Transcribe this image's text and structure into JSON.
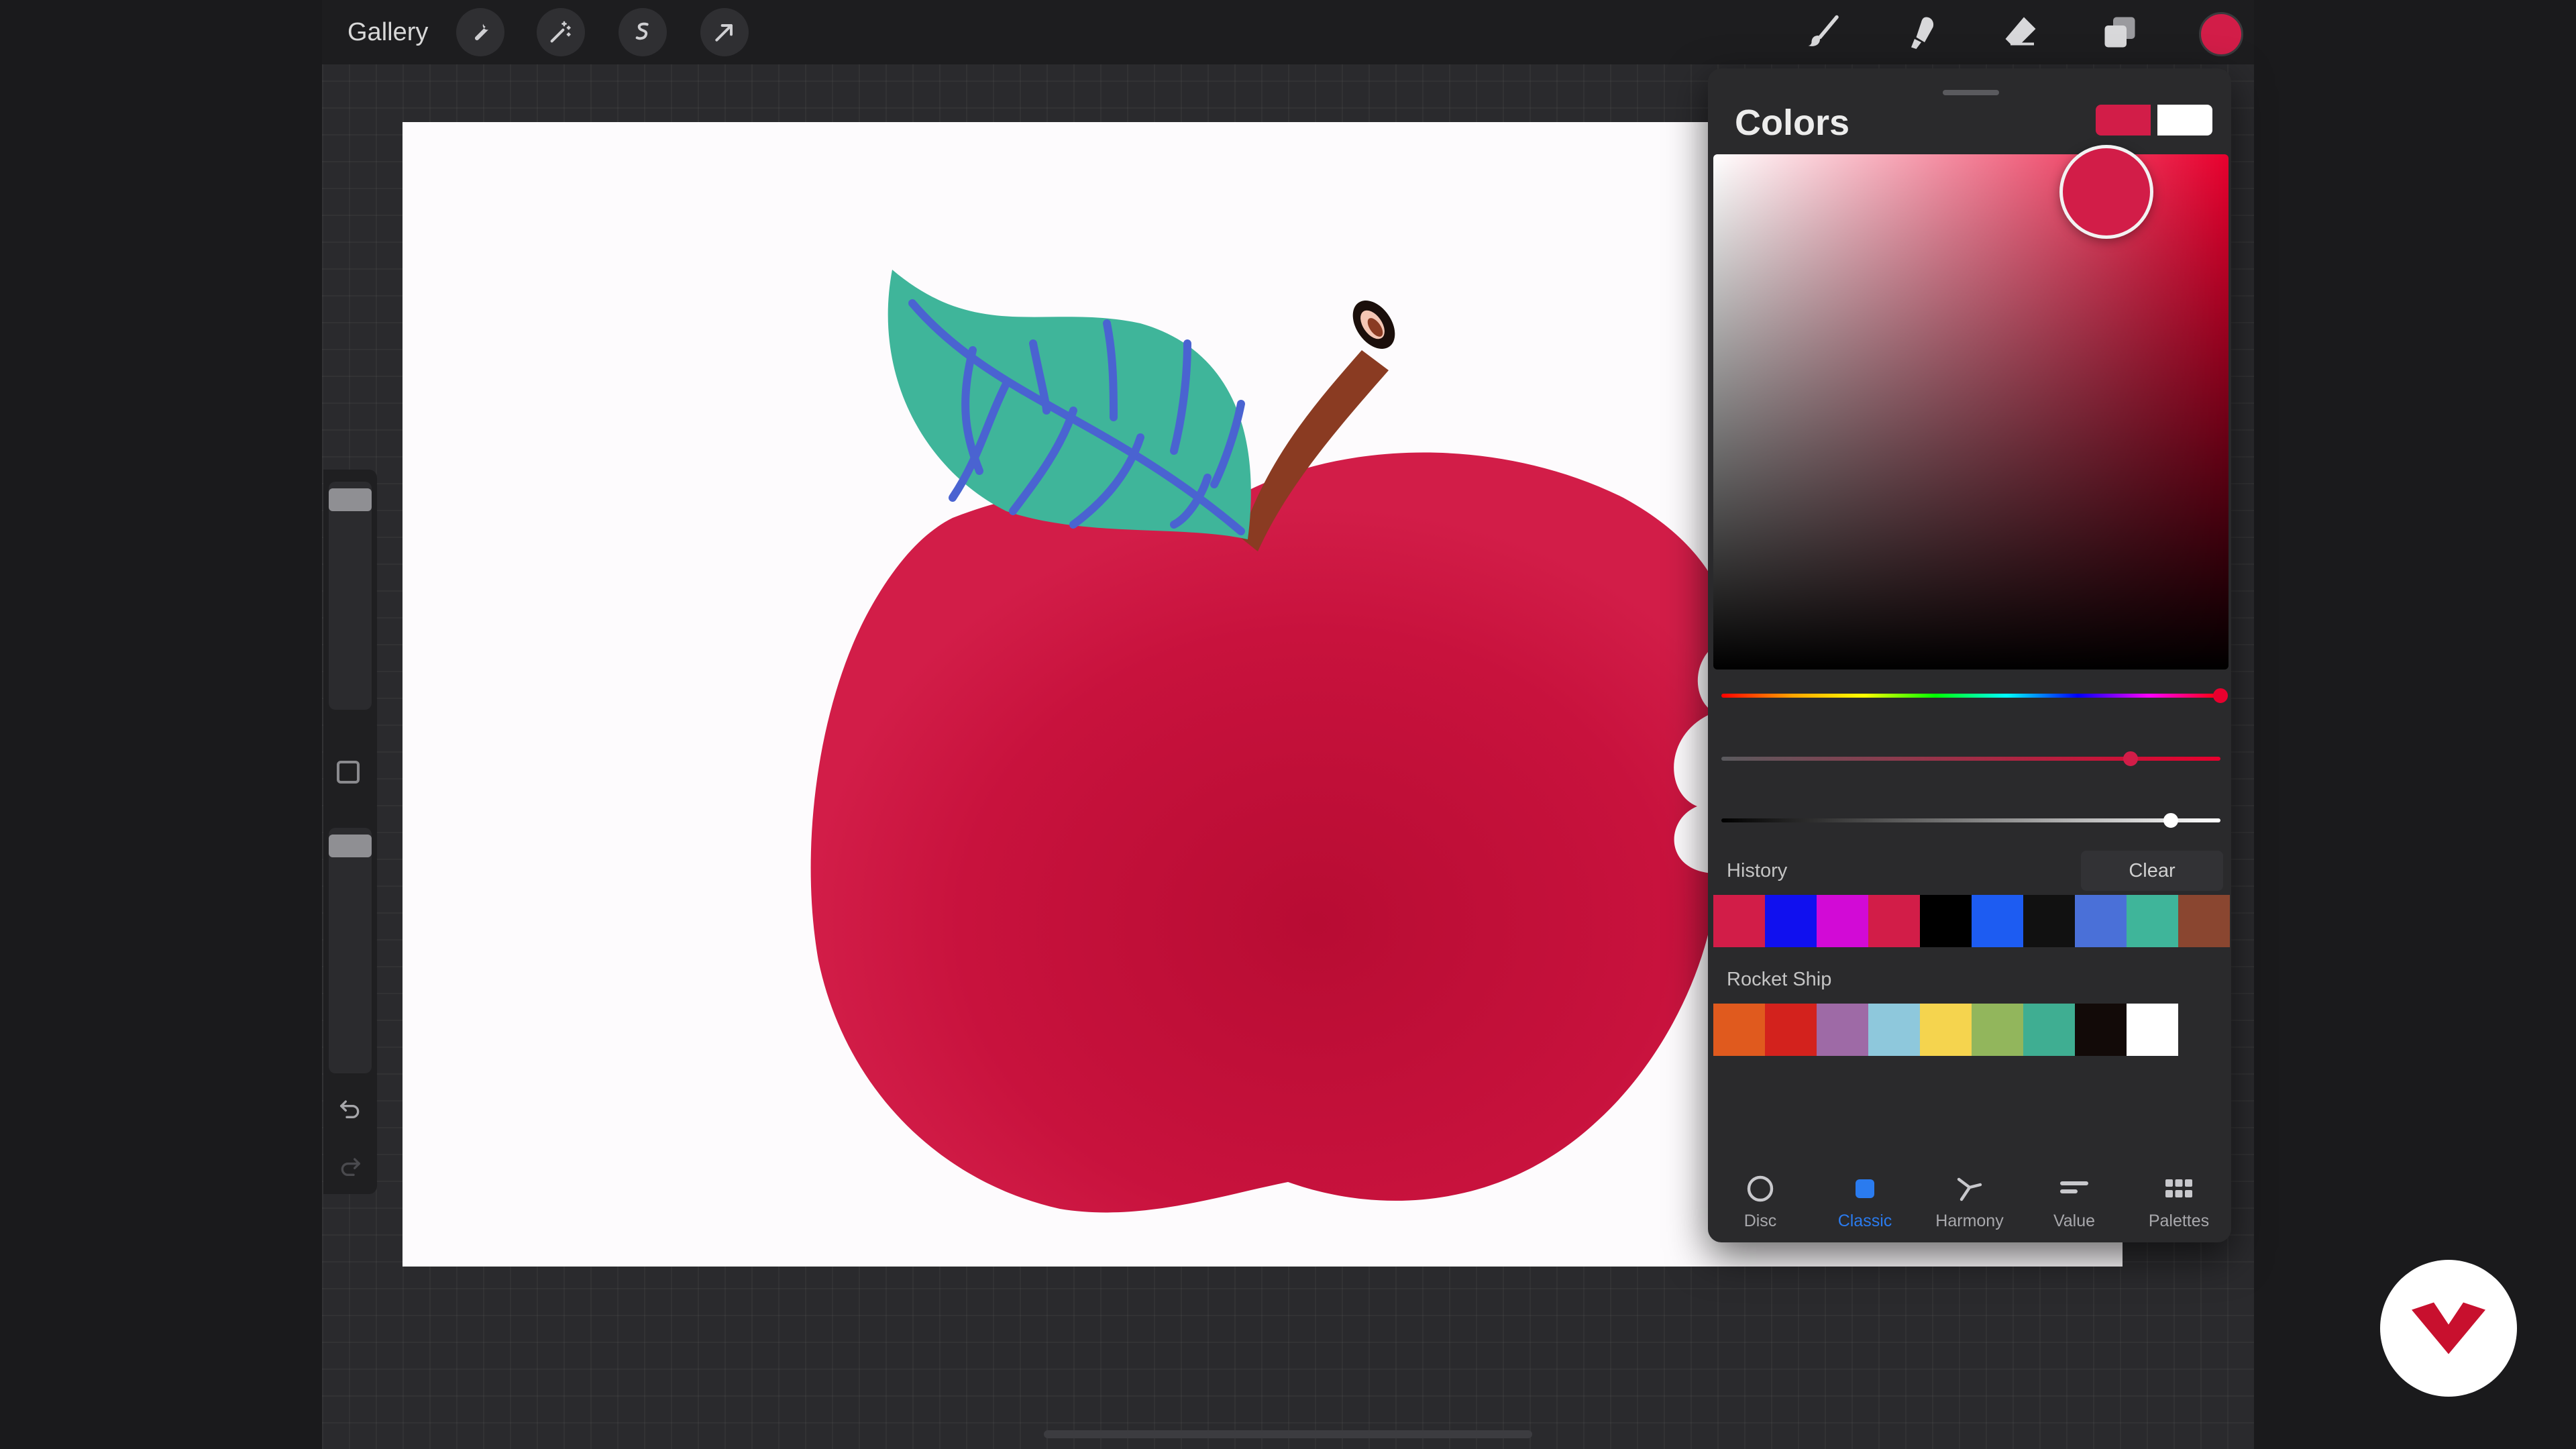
{
  "toolbar": {
    "gallery_label": "Gallery",
    "left_tools": [
      "wrench-icon",
      "magic-wand-icon",
      "selection-s-icon",
      "transform-arrow-icon"
    ],
    "right_tools": [
      "brush-icon",
      "smudge-icon",
      "eraser-icon",
      "layers-icon"
    ],
    "current_color": "#d21d48"
  },
  "colors_panel": {
    "title": "Colors",
    "primary_color": "#d21d48",
    "secondary_color": "#ffffff",
    "hue_level": 1.0,
    "saturation_level": 0.82,
    "brightness_level": 0.9,
    "history_label": "History",
    "clear_label": "Clear",
    "history": [
      "#d21d48",
      "#1010ef",
      "#d20ad6",
      "#d21d48",
      "#000000",
      "#1d5cf2",
      "#111111",
      "#4a70d8",
      "#3fb59a",
      "#8a4630"
    ],
    "palette_name": "Rocket Ship",
    "palette": [
      "#e05a1e",
      "#d3221d",
      "#9e6aa6",
      "#8ec8dc",
      "#f5d44e",
      "#92b65c",
      "#3fae92",
      "#120a08",
      "#ffffff"
    ],
    "tabs": [
      {
        "label": "Disc",
        "icon": "disc-icon",
        "active": false
      },
      {
        "label": "Classic",
        "icon": "classic-square-icon",
        "active": true
      },
      {
        "label": "Harmony",
        "icon": "harmony-icon",
        "active": false
      },
      {
        "label": "Value",
        "icon": "value-sliders-icon",
        "active": false
      },
      {
        "label": "Palettes",
        "icon": "palettes-grid-icon",
        "active": false
      }
    ]
  },
  "colors": {
    "accent": "#2a7bef",
    "apple_red": "#d21d48",
    "leaf_green": "#3fb59a",
    "vein_blue": "#4a63d1",
    "stem_brown": "#8a3b22",
    "logo_red": "#c8102e"
  }
}
